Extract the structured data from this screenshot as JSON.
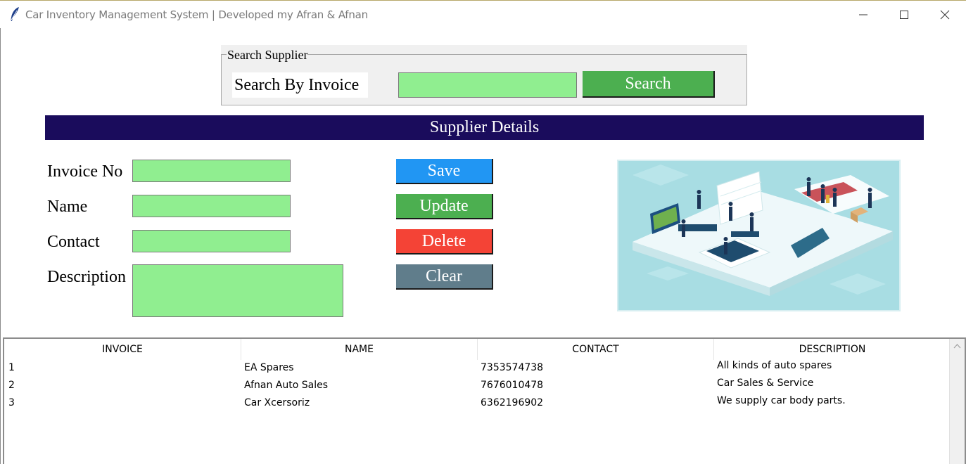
{
  "window": {
    "title": "Car Inventory Management System | Developed my Afran & Afnan"
  },
  "search": {
    "group_title": "Search Supplier",
    "label": "Search By Invoice",
    "input_value": "",
    "button_label": "Search"
  },
  "section": {
    "header": "Supplier Details"
  },
  "form": {
    "invoice_label": "Invoice No",
    "name_label": "Name",
    "contact_label": "Contact",
    "description_label": "Description",
    "invoice_value": "",
    "name_value": "",
    "contact_value": "",
    "description_value": ""
  },
  "buttons": {
    "save": "Save",
    "update": "Update",
    "delete": "Delete",
    "clear": "Clear"
  },
  "colors": {
    "input_bg": "#90ee90",
    "header_bg": "#1a0c5c",
    "save": "#2196f3",
    "update": "#4caf50",
    "delete": "#f44336",
    "clear": "#607d8b",
    "search": "#4caf50"
  },
  "table": {
    "columns": [
      "INVOICE",
      "NAME",
      "CONTACT",
      "DESCRIPTION"
    ],
    "rows": [
      [
        "1",
        "EA Spares",
        "7353574738",
        "All kinds of auto spares"
      ],
      [
        "2",
        "Afnan Auto Sales",
        "7676010478",
        "Car Sales & Service"
      ],
      [
        "3",
        "Car Xcersoriz",
        "6362196902",
        "We supply car body parts."
      ]
    ]
  },
  "icons": {
    "app": "feather-icon",
    "minimize": "minimize-icon",
    "maximize": "maximize-icon",
    "close": "close-icon",
    "scroll_up": "chevron-up-icon"
  }
}
